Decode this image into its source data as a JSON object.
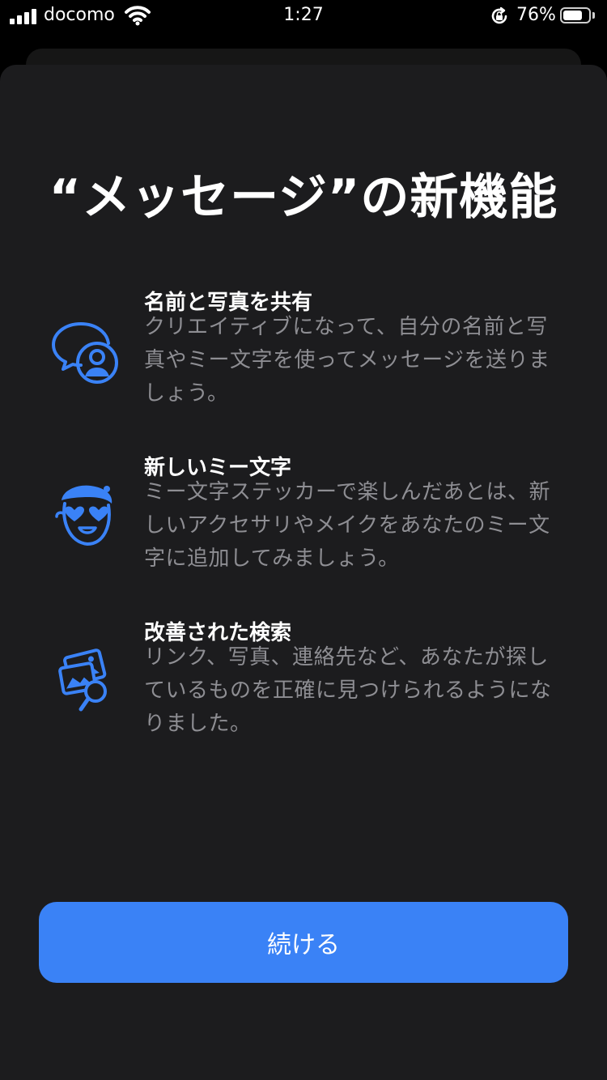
{
  "status_bar": {
    "carrier": "docomo",
    "time": "1:27",
    "battery_percent": "76%",
    "battery_level": 0.76
  },
  "title": "“メッセージ”の新機能",
  "features": [
    {
      "icon": "chat-person-icon",
      "title": "名前と写真を共有",
      "description": "クリエイティブになって、自分の名前と写真やミー文字を使ってメッセージを送りましょう。"
    },
    {
      "icon": "memoji-icon",
      "title": "新しいミー文字",
      "description": "ミー文字ステッカーで楽しんだあとは、新しいアクセサリやメイクをあなたのミー文字に追加してみましょう。"
    },
    {
      "icon": "photo-search-icon",
      "title": "改善された検索",
      "description": "リンク、写真、連絡先など、あなたが探しているものを正確に見つけられるようになりました。"
    }
  ],
  "continue_button": {
    "label": "続ける"
  },
  "colors": {
    "accent": "#3a82f6",
    "sheet_background": "#1c1c1e",
    "secondary_text": "#8e8e93"
  }
}
